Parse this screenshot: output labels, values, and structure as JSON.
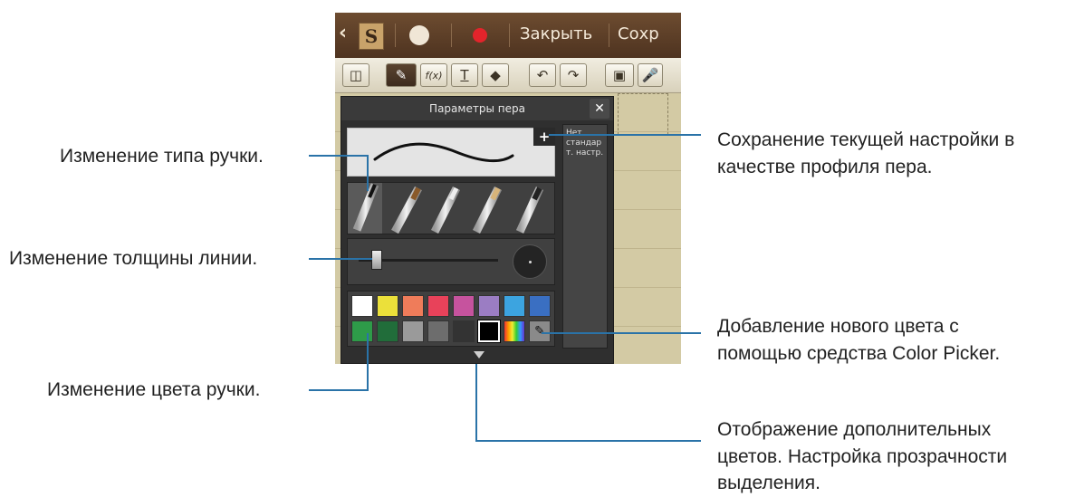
{
  "app_bar": {
    "close_label": "Закрыть",
    "save_label": "Сохр",
    "colors": {
      "bar": "#5a3c26",
      "record": "#e3242b"
    }
  },
  "pen_panel": {
    "title": "Параметры пера",
    "add_profile_label": "+",
    "close_label": "✕",
    "profile_placeholder": "Нет стандар т. настр.",
    "thickness": 0.1,
    "palette": [
      "#ffffff",
      "#ebe03a",
      "#ef7c5a",
      "#e8425a",
      "#c6539e",
      "#9b7dc3",
      "#3ca4e0",
      "#3a6fc2",
      "#2e9b49",
      "#216d3a",
      "#9a9a9a",
      "#6d6d6d",
      "#333333",
      "#000000",
      "rainbow",
      "picker"
    ],
    "selected_color": "#000000"
  },
  "callouts": {
    "pen_type": "Изменение типа ручки.",
    "line_thickness": "Изменение толщины линии.",
    "pen_color": "Изменение цвета ручки.",
    "save_profile_1": "Сохранение текущей настройки в",
    "save_profile_2": "качестве профиля пера.",
    "color_picker_1": "Добавление нового цвета с",
    "color_picker_2": "помощью средства Color Picker.",
    "more_colors_1": "Отображение дополнительных",
    "more_colors_2": "цветов. Настройка прозрачности",
    "more_colors_3": "выделения."
  }
}
